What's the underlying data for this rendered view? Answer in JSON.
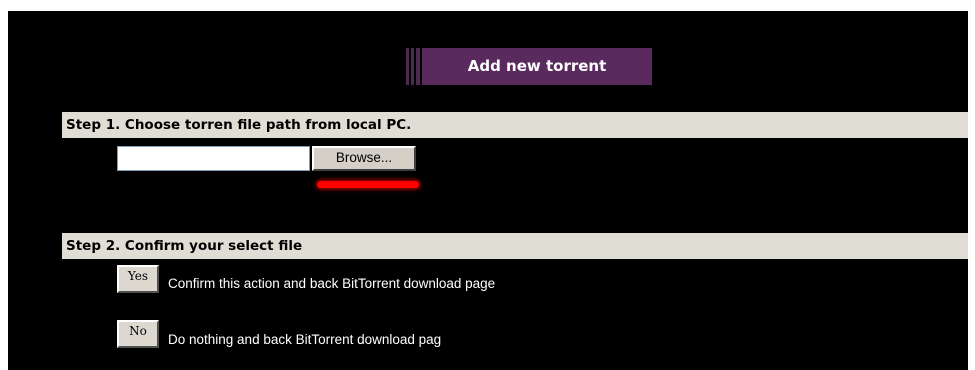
{
  "title": "Add new torrent",
  "step1": {
    "header": "Step 1. Choose torren file path from local PC.",
    "file_value": "",
    "browse_label": "Browse..."
  },
  "step2": {
    "header": "Step 2. Confirm your select file",
    "yes_label": "Yes",
    "yes_description": "Confirm this action and back BitTorrent download page",
    "no_label": "No",
    "no_description": "Do nothing and back BitTorrent download pag"
  },
  "colors": {
    "background": "#000000",
    "title_box": "#5a2a5e",
    "step_header": "#e0ddd4",
    "highlight": "#ff0000"
  }
}
